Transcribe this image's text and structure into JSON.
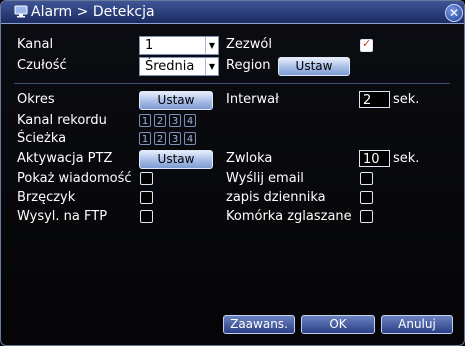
{
  "title": "Alarm > Detekcja",
  "left": {
    "kanal_label": "Kanal",
    "kanal_value": "1",
    "czulosc_label": "Czułość",
    "czulosc_value": "Średnia",
    "okres_label": "Okres",
    "okres_button": "Ustaw",
    "kanal_rekordu_label": "Kanal rekordu",
    "sciezka_label": "Ścieżka",
    "aktywacja_label": "Aktywacja PTZ",
    "aktywacja_button": "Ustaw",
    "pokaz_label": "Pokaż wiadomość",
    "brzeczyk_label": "Brzęczyk",
    "ftp_label": "Wysyl. na FTP"
  },
  "right": {
    "zezwol_label": "Zezwól",
    "region_label": "Region",
    "region_button": "Ustaw",
    "interwal_label": "Interwał",
    "interwal_value": "2",
    "interwal_unit": "sek.",
    "zwloka_label": "Zwloka",
    "zwloka_value": "10",
    "zwloka_unit": "sek.",
    "email_label": "Wyślij email",
    "dziennik_label": "zapis dziennika",
    "komorka_label": "Komórka zglaszane"
  },
  "channels": [
    "1",
    "2",
    "3",
    "4"
  ],
  "checkboxes": {
    "zezwol": true,
    "pokaz": false,
    "brzeczyk": false,
    "ftp": false,
    "email": false,
    "dziennik": false,
    "komorka": false
  },
  "footer": {
    "advanced": "Zaawans.",
    "ok": "OK",
    "cancel": "Anuluj"
  },
  "icons": {
    "title_logo": "monitor-icon",
    "close": "close-icon",
    "dropdown": "chevron-down-icon",
    "check": "checkmark-icon"
  },
  "colors": {
    "titlebar": "#2c3f7a",
    "background": "#07080c",
    "button_light": "#a7bde6",
    "button_dark": "#2a3f85",
    "check_mark": "#c0392b"
  }
}
